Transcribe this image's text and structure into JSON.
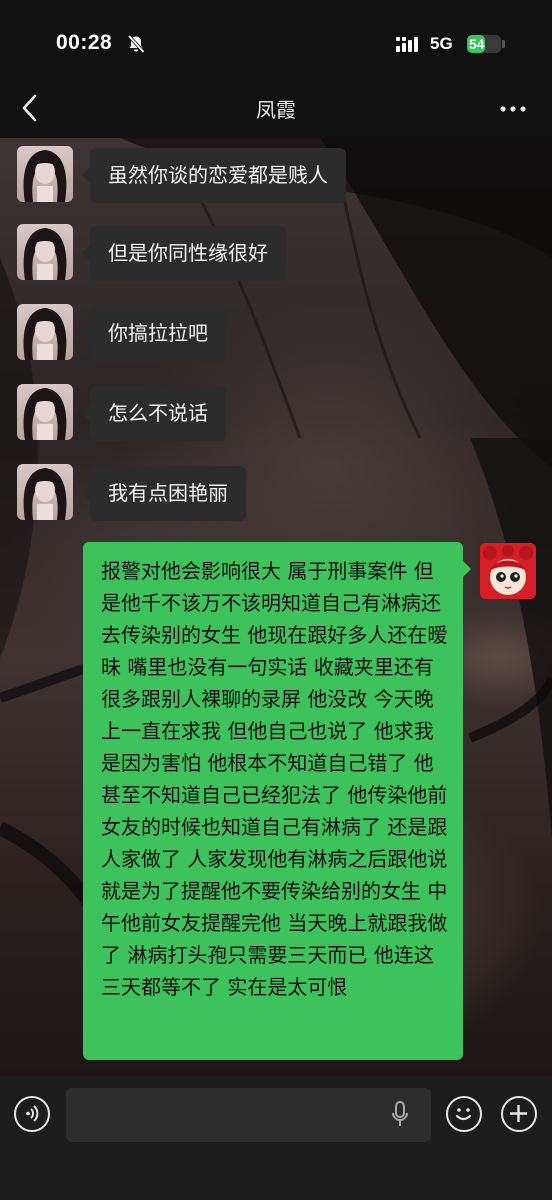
{
  "status_bar": {
    "time": "00:28",
    "network": "5G",
    "battery": "54",
    "battery_level": 0.54,
    "battery_color": "#34c759",
    "icons": [
      "mute-bell-icon",
      "signal-bars-icon",
      "battery-icon"
    ]
  },
  "nav": {
    "back_icon": "chevron-left-icon",
    "title": "凤霞",
    "more_icon": "more-dots-icon"
  },
  "messages": [
    {
      "from": "contact",
      "text": "虽然你谈的恋爱都是贱人"
    },
    {
      "from": "contact",
      "text": "但是你同性缘很好"
    },
    {
      "from": "contact",
      "text": "你搞拉拉吧"
    },
    {
      "from": "contact",
      "text": "怎么不说话"
    },
    {
      "from": "contact",
      "text": "我有点困艳丽"
    },
    {
      "from": "me",
      "text": "报警对他会影响很大 属于刑事案件 但是他千不该万不该明知道自己有淋病还去传染别的女生 他现在跟好多人还在暧昧 嘴里也没有一句实话 收藏夹里还有很多跟别人裸聊的录屏 他没改 今天晚上一直在求我 但他自己也说了 他求我是因为害怕 他根本不知道自己错了 他甚至不知道自己已经犯法了 他传染他前女友的时候也知道自己有淋病了 还是跟人家做了 人家发现他有淋病之后跟他说就是为了提醒他不要传染给别的女生 中午他前女友提醒完他 当天晚上就跟我做了 淋病打头孢只需要三天而已 他连这三天都等不了 实在是太可恨"
    }
  ],
  "colors": {
    "outgoing_bubble": "#3dc25c",
    "incoming_bubble": "#2c2c2c",
    "bar_background": "#111111"
  },
  "input_bar": {
    "voice_icon": "voice-toggle-icon",
    "mic_icon": "microphone-icon",
    "emoji_icon": "emoji-face-icon",
    "plus_icon": "plus-circle-icon"
  }
}
